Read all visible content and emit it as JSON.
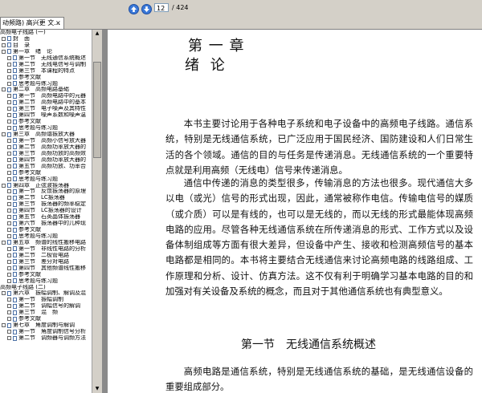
{
  "tab": {
    "label": "动频路) 高兴更 文..."
  },
  "toolbar": {
    "page_current": "12",
    "page_total": "/ 424"
  },
  "sidebar": {
    "bookmarks": [
      {
        "text": "高频电子线路 (一)",
        "level": 0
      },
      {
        "text": "封　面",
        "level": 1
      },
      {
        "text": "目　录",
        "level": 1
      },
      {
        "text": "第一章　绪　论",
        "level": 1
      },
      {
        "text": "第一节　无线通信系统概述",
        "level": 2
      },
      {
        "text": "第二节　无线电信号与调制",
        "level": 2
      },
      {
        "text": "第三节　本课程的特点",
        "level": 2
      },
      {
        "text": "参考文献",
        "level": 2
      },
      {
        "text": "思考题与练习题",
        "level": 2
      },
      {
        "text": "第二章　高频电路基础",
        "level": 1
      },
      {
        "text": "第一节　高频电路中的元器",
        "level": 2
      },
      {
        "text": "第二节　高频电路中的基本",
        "level": 2
      },
      {
        "text": "第三节　电子噪声及其特性",
        "level": 2
      },
      {
        "text": "第四节　噪声系数和噪声温",
        "level": 2
      },
      {
        "text": "参考文献",
        "level": 2
      },
      {
        "text": "思考题与练习题",
        "level": 2
      },
      {
        "text": "第三章　高频谐振放大器",
        "level": 1
      },
      {
        "text": "第一节　高频小信号放大器",
        "level": 2
      },
      {
        "text": "第二节　高频功率放大器的",
        "level": 2
      },
      {
        "text": "第三节　高频功放的高频效",
        "level": 2
      },
      {
        "text": "第四节　高频功率放大器的",
        "level": 2
      },
      {
        "text": "第五节　高频功放、功率合",
        "level": 2
      },
      {
        "text": "参考文献",
        "level": 2
      },
      {
        "text": "思考题与练习题",
        "level": 2
      },
      {
        "text": "第四章　正弦波振荡器",
        "level": 1
      },
      {
        "text": "第一节　反馈振荡器的原理",
        "level": 2
      },
      {
        "text": "第二节　LC振荡器",
        "level": 2
      },
      {
        "text": "第三节　振荡器的频率稳定",
        "level": 2
      },
      {
        "text": "第四节　LC振荡器的设计",
        "level": 2
      },
      {
        "text": "第五节　石英晶体振荡器",
        "level": 2
      },
      {
        "text": "第六节　振荡器中的几种现",
        "level": 2
      },
      {
        "text": "参考文献",
        "level": 2
      },
      {
        "text": "思考题与练习题",
        "level": 2
      },
      {
        "text": "第五章　频谱的线性搬移电路",
        "level": 1
      },
      {
        "text": "第一节　非线性电路的分析",
        "level": 2
      },
      {
        "text": "第二节　二极管电路",
        "level": 2
      },
      {
        "text": "第三节　差分对电路",
        "level": 2
      },
      {
        "text": "第四节　其他频谱线性搬移",
        "level": 2
      },
      {
        "text": "参考文献",
        "level": 2
      },
      {
        "text": "思考题与练习题",
        "level": 2
      },
      {
        "text": "高频电子线路 (二)",
        "level": 0
      },
      {
        "text": "第六章　振幅调制、解调及混",
        "level": 1
      },
      {
        "text": "第一节　振幅调制",
        "level": 2
      },
      {
        "text": "第二节　调幅信号的解调",
        "level": 2
      },
      {
        "text": "第三节　混　频",
        "level": 2
      },
      {
        "text": "参考文献",
        "level": 2
      },
      {
        "text": "第七章　角度调制与解调",
        "level": 1
      },
      {
        "text": "第一节　角度调制信号分析",
        "level": 2
      },
      {
        "text": "第二节　调频器与调频方法",
        "level": 2
      }
    ]
  },
  "document": {
    "chapter_number": "第 一 章",
    "chapter_title": "绪 论",
    "paragraph1": "本书主要讨论用于各种电子系统和电子设备中的高频电子线路。通信系统，特别是无线通信系统，已广泛应用于国民经济、国防建设和人们日常生活的各个领域。通信的目的与任务是传递消息。无线通信系统的一个重要特点就是利用高频（无线电）信号来传递消息。",
    "paragraph2": "通信中传递的消息的类型很多，传输消息的方法也很多。现代通信大多以电（或光）信号的形式出现，因此，通常被称作电信。传输电信号的媒质（或介质）可以是有线的，也可以是无线的，而以无线的形式最能体现高频电路的应用。尽管各种无线通信系统在所传递消息的形式、工作方式以及设备体制组成等方面有很大差异，但设备中产生、接收和检测高频信号的基本电路都是相同的。本书将主要结合无线通信来讨论高频电路的线路组成、工作原理和分析、设计、仿真方法。这不仅有利于明确学习基本电路的目的和加强对有关设备及系统的概念，而且对于其他通信系统也有典型意义。",
    "section_title": "第一节　无线通信系统概述",
    "paragraph3": "高频电路是通信系统，特别是无线通信系统的基础，是无线通信设备的重要组成部分。"
  },
  "icons": {
    "prev": "up-arrow-circle-icon",
    "next": "down-arrow-circle-icon"
  },
  "colors": {
    "toolbar": "#d4d0c8",
    "viewer_bg": "#808080",
    "nav_blue": "#2f6bd8"
  }
}
